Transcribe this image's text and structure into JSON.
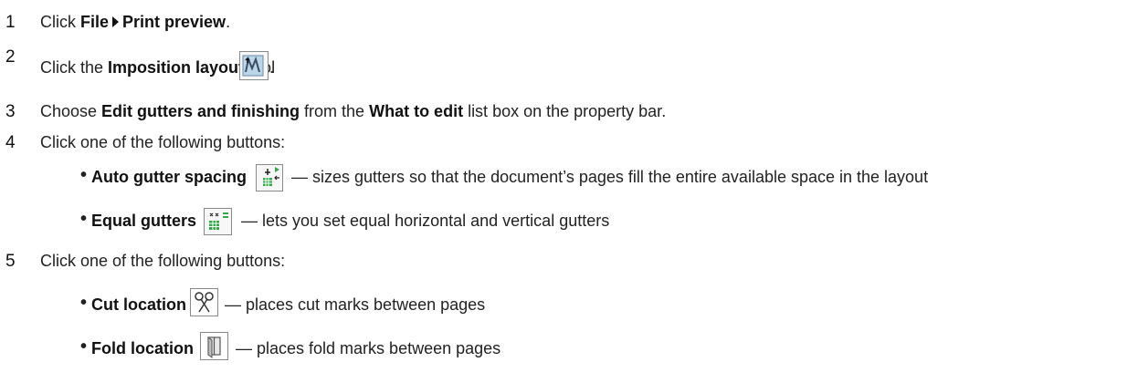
{
  "steps": [
    {
      "num": "1",
      "pre": "Click ",
      "b1": "File",
      "b2": "Print preview",
      "post": "."
    },
    {
      "num": "2",
      "pre": "Click the ",
      "b1": "Imposition layout",
      "post": " tool"
    },
    {
      "num": "3",
      "pre": "Choose ",
      "b1": "Edit gutters and finishing",
      "mid": " from the ",
      "b2": "What to edit",
      "post": " list box on the property bar."
    },
    {
      "num": "4",
      "text": "Click one of the following buttons:"
    },
    {
      "num": "5",
      "text": "Click one of the following buttons:"
    }
  ],
  "bullets4": [
    {
      "label": "Auto gutter spacing",
      "desc": "— sizes gutters so that the document’s pages fill the entire available space in the layout",
      "icon": "auto-gutter-icon"
    },
    {
      "label": "Equal gutters",
      "desc": "— lets you set equal horizontal and vertical gutters",
      "icon": "equal-gutters-icon"
    }
  ],
  "bullets5": [
    {
      "label": "Cut location",
      "desc": "— places cut marks between pages",
      "icon": "scissors-icon"
    },
    {
      "label": "Fold location",
      "desc": "— places fold marks between pages",
      "icon": "fold-icon"
    }
  ],
  "bullet_char": "•"
}
